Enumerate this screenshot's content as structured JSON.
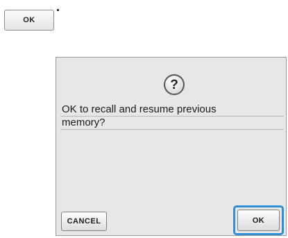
{
  "top_key": {
    "label": "OK"
  },
  "dialog": {
    "icon": "question-icon",
    "icon_glyph": "?",
    "message_lines": [
      "OK to recall and resume previous",
      "memory?"
    ],
    "cancel_label": "CANCEL",
    "ok_label": "OK",
    "highlight_color": "#2f8fd6"
  }
}
